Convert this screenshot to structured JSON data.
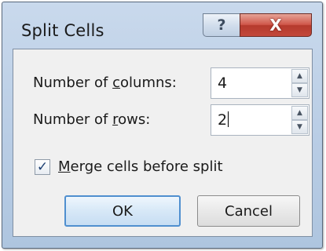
{
  "dialog": {
    "title": "Split Cells",
    "help_icon": "help-icon",
    "help_glyph": "?",
    "close_icon": "close-icon",
    "close_glyph": "X"
  },
  "fields": [
    {
      "label_pre": "Number of ",
      "label_key": "c",
      "label_post": "olumns:",
      "value": "4"
    },
    {
      "label_pre": "Number of ",
      "label_key": "r",
      "label_post": "ows:",
      "value": "2"
    }
  ],
  "spin_icons": {
    "up": "▲",
    "down": "▼"
  },
  "merge": {
    "checked": true,
    "check_glyph": "✓",
    "label_key": "M",
    "label_rest": "erge cells before split"
  },
  "buttons": {
    "ok_label": "OK",
    "cancel_label": "Cancel"
  },
  "colors": {
    "title_bar": "#b9cde5",
    "close_button": "#c94f42",
    "default_button_border": "#4f8fcf"
  }
}
